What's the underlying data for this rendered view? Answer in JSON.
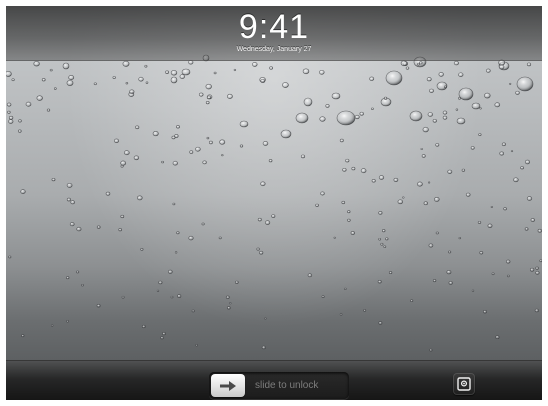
{
  "status_bar": {
    "time": "9:41",
    "date": "Wednesday, January 27"
  },
  "lock_bar": {
    "slider_label": "slide to unlock",
    "slider_icon": "arrow-right-icon",
    "camera_icon": "picture-frame-icon"
  },
  "wallpaper": {
    "icon": "water-drops-wallpaper"
  }
}
